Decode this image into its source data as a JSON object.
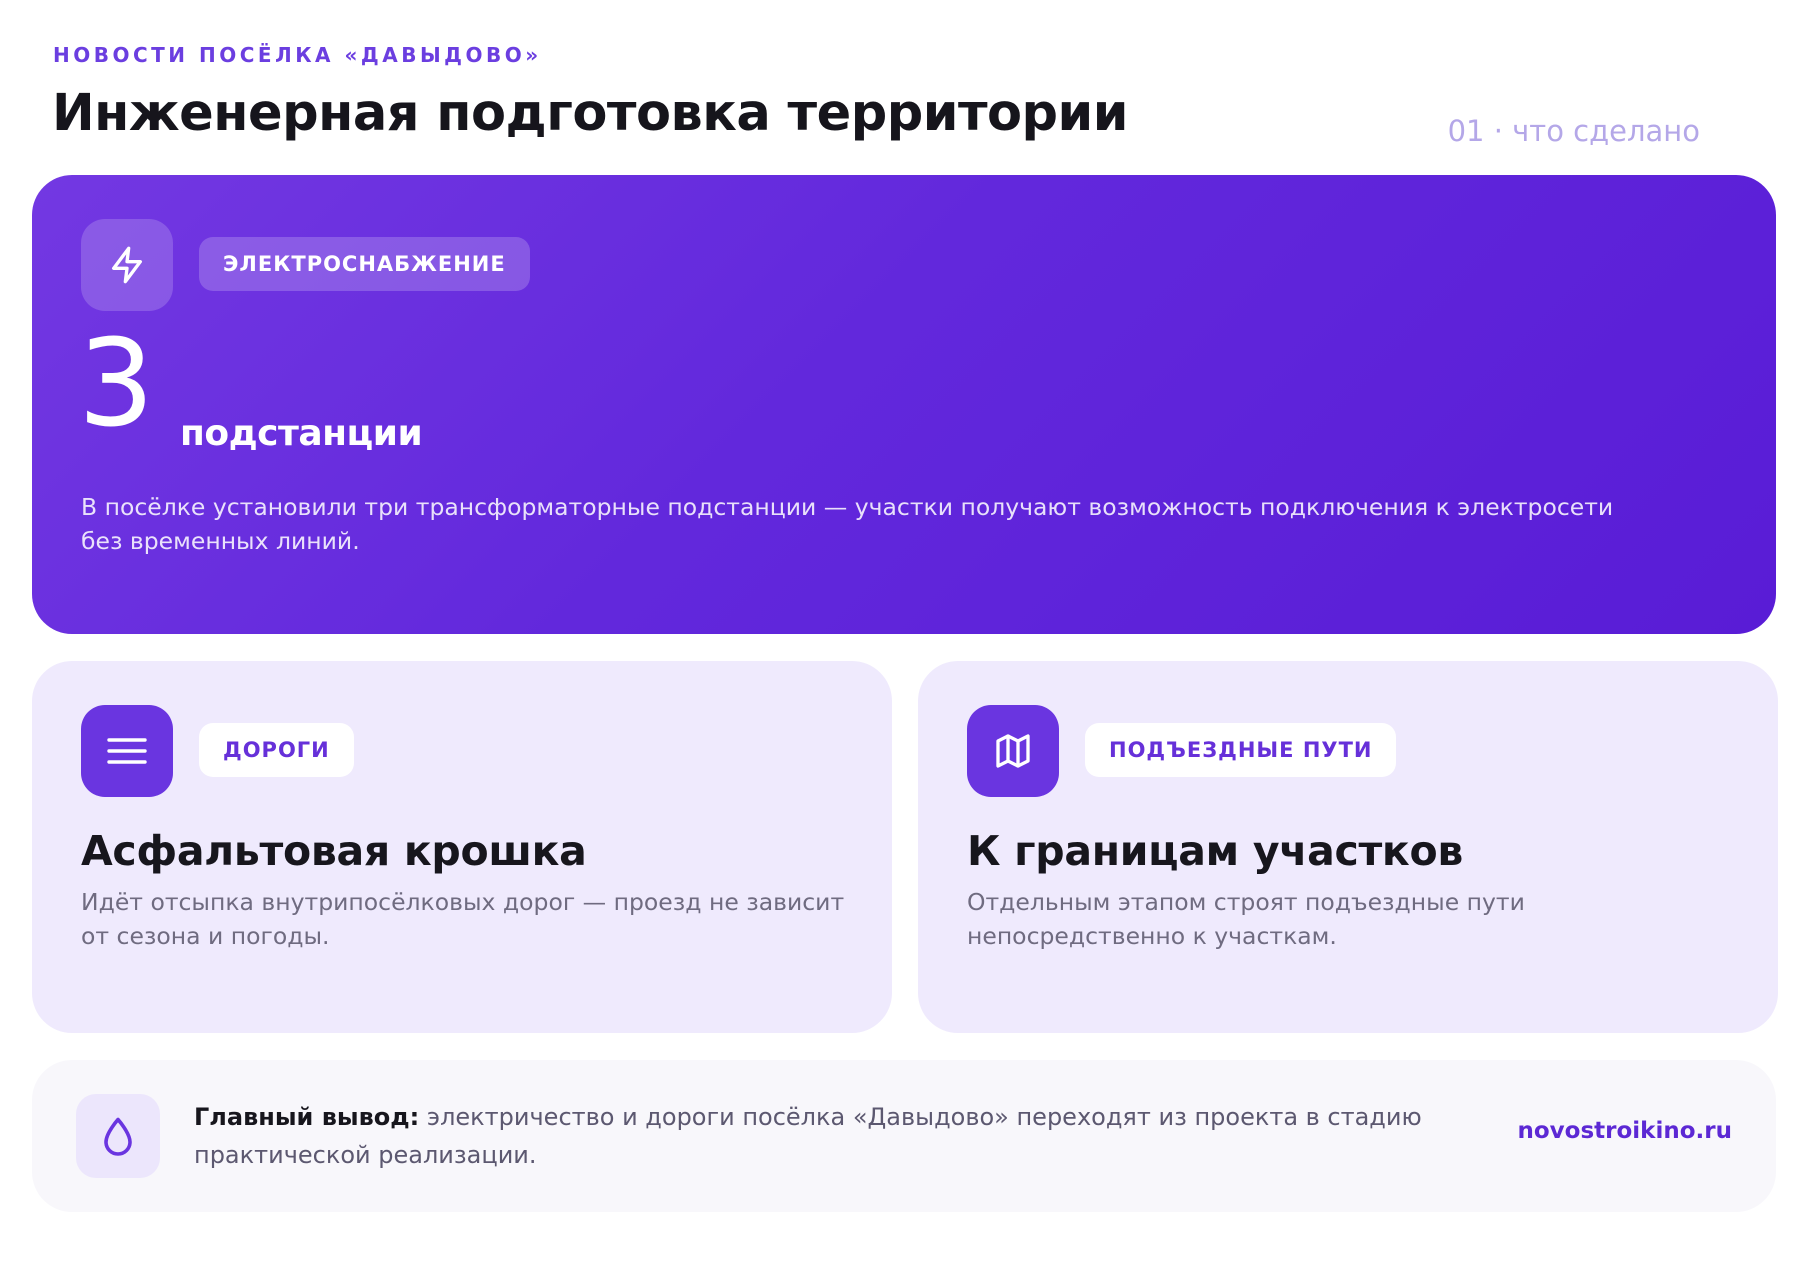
{
  "header": {
    "kicker": "НОВОСТИ ПОСЁЛКА «ДАВЫДОВО»",
    "title": "Инженерная подготовка территории",
    "section": "01 · что сделано"
  },
  "hero": {
    "icon": "lightning-icon",
    "tag": "ЭЛЕКТРОСНАБЖЕНИЕ",
    "number": "3",
    "unit": "подстанции",
    "description": "В посёлке установили три трансформаторные подстанции — участки получают возможность подключения к электросети без временных линий."
  },
  "cards": [
    {
      "icon": "menu-lines-icon",
      "tag": "ДОРОГИ",
      "title": "Асфальтовая крошка",
      "description": "Идёт отсыпка внутрипосёлковых дорог — проезд не зависит от сезона и погоды."
    },
    {
      "icon": "map-icon",
      "tag": "ПОДЪЕЗДНЫЕ ПУТИ",
      "title": "К границам участков",
      "description": "Отдельным этапом строят подъездные пути непосредственно к участкам."
    }
  ],
  "footer": {
    "icon": "droplet-icon",
    "lead": "Главный вывод:",
    "text": "электричество и дороги посёлка «Давыдово» переходят из проекта в стадию практической реализации.",
    "site": "novostroikino.ru"
  },
  "colors": {
    "accent": "#6a35e0",
    "hero_bg": "#6228dc",
    "card_bg": "#efeafd",
    "footer_bg": "#f8f7fb"
  }
}
